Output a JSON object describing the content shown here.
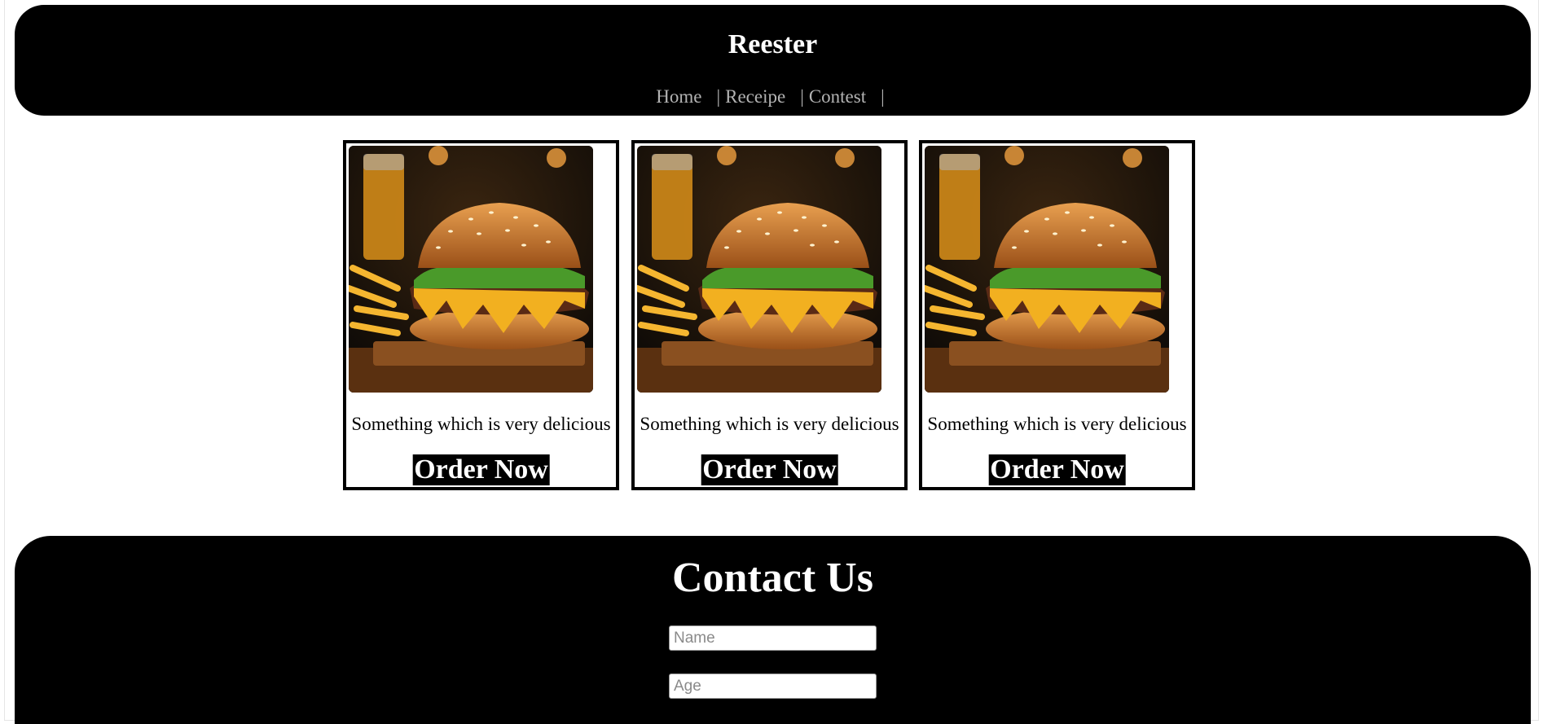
{
  "header": {
    "brand": "Reester",
    "nav": [
      {
        "label": "Home"
      },
      {
        "label": "Receipe"
      },
      {
        "label": "Contest"
      }
    ],
    "separator": "|"
  },
  "cards": [
    {
      "image_icon": "burger-photo",
      "description": "Something which is very delicious",
      "button_label": "Order Now"
    },
    {
      "image_icon": "burger-photo",
      "description": "Something which is very delicious",
      "button_label": "Order Now"
    },
    {
      "image_icon": "burger-photo",
      "description": "Something which is very delicious",
      "button_label": "Order Now"
    }
  ],
  "contact": {
    "title": "Contact Us",
    "fields": [
      {
        "placeholder": "Name",
        "value": ""
      },
      {
        "placeholder": "Age",
        "value": ""
      }
    ]
  },
  "colors": {
    "header_bg": "#000000",
    "nav_text": "#b3b3b3",
    "button_bg": "#000000",
    "button_text": "#ffffff"
  }
}
